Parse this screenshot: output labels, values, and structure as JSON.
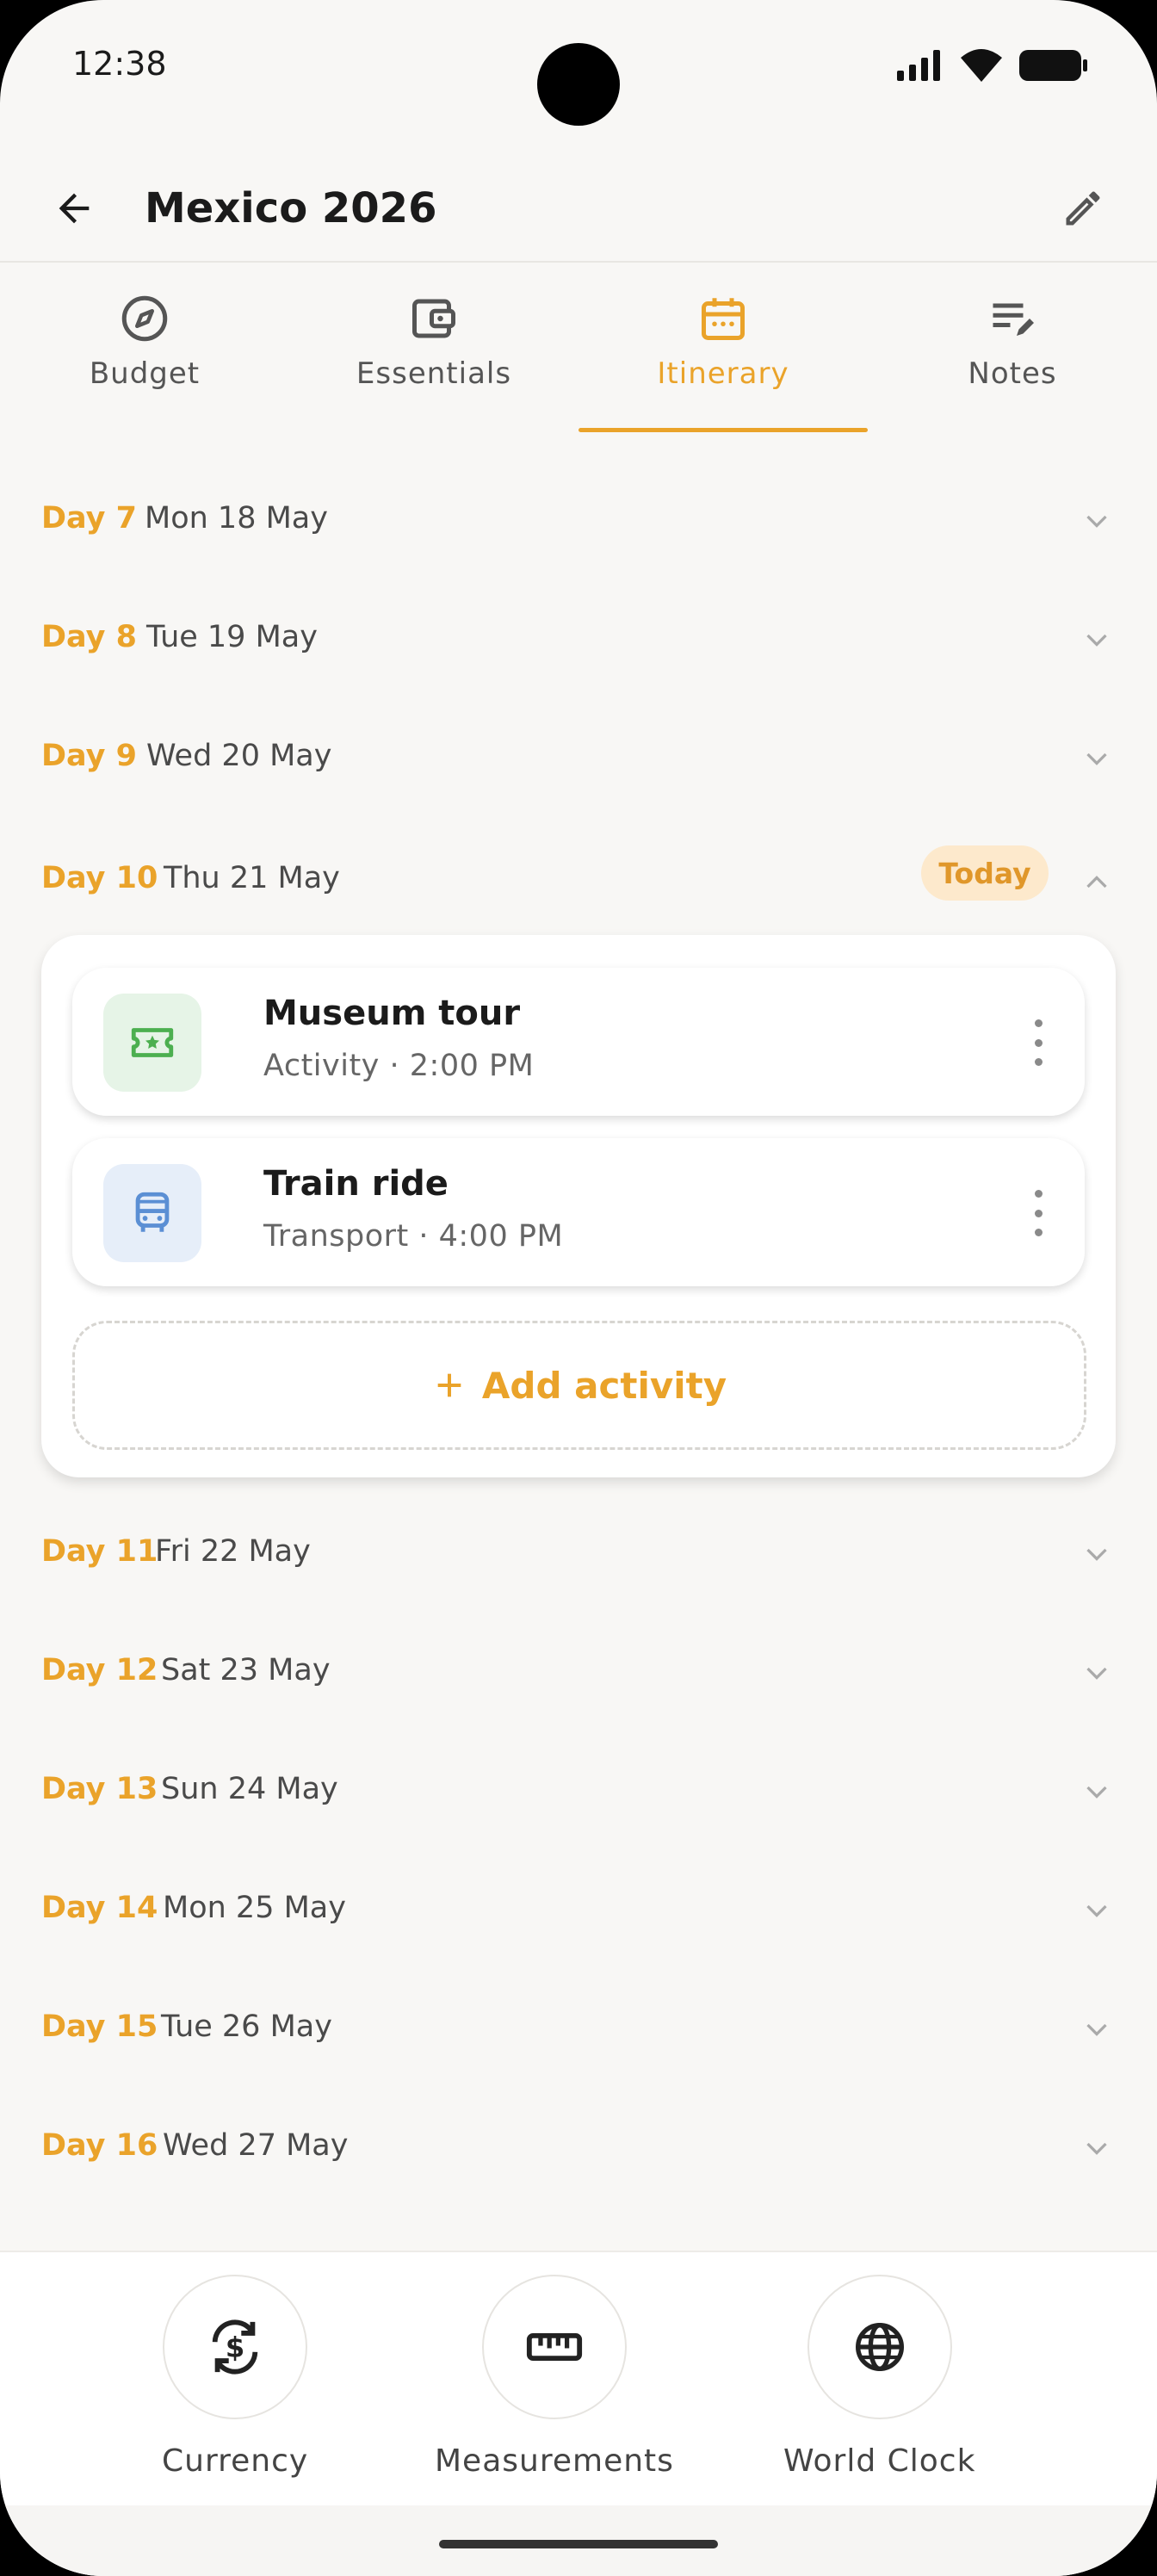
{
  "status_bar": {
    "time": "12:38"
  },
  "header": {
    "title": "Mexico 2026"
  },
  "tabs": [
    {
      "label": "Budget",
      "icon": "compass-icon",
      "active": false
    },
    {
      "label": "Essentials",
      "icon": "wallet-icon",
      "active": false
    },
    {
      "label": "Itinerary",
      "icon": "calendar-icon",
      "active": true
    },
    {
      "label": "Notes",
      "icon": "notes-edit-icon",
      "active": false
    }
  ],
  "days": [
    {
      "day": "Day 7",
      "date": "Mon 18 May"
    },
    {
      "day": "Day 8",
      "date": "Tue 19 May"
    },
    {
      "day": "Day 9",
      "date": "Wed 20 May"
    },
    {
      "day": "Day 10",
      "date": "Thu 21 May",
      "badge": "Today",
      "expanded": true
    },
    {
      "day": "Day 11",
      "date": "Fri 22 May"
    },
    {
      "day": "Day 12",
      "date": "Sat 23 May"
    },
    {
      "day": "Day 13",
      "date": "Sun 24 May"
    },
    {
      "day": "Day 14",
      "date": "Mon 25 May"
    },
    {
      "day": "Day 15",
      "date": "Tue 26 May"
    },
    {
      "day": "Day 16",
      "date": "Wed 27 May"
    }
  ],
  "activities": [
    {
      "title": "Museum tour",
      "subtitle": "Activity · 2:00 PM",
      "icon": "ticket-icon",
      "color": "#4caf50",
      "bg": "#e6f4e7"
    },
    {
      "title": "Train ride",
      "subtitle": "Transport · 4:00 PM",
      "icon": "bus-icon",
      "color": "#5b8fd4",
      "bg": "#e6eef9"
    }
  ],
  "add_activity_label": "Add activity",
  "tools": [
    {
      "label": "Currency",
      "icon": "currency-exchange-icon"
    },
    {
      "label": "Measurements",
      "icon": "ruler-icon"
    },
    {
      "label": "World Clock",
      "icon": "globe-icon"
    }
  ],
  "colors": {
    "accent": "#eaa32a",
    "background": "#f8f7f5",
    "badge_bg": "#fde9cc"
  }
}
